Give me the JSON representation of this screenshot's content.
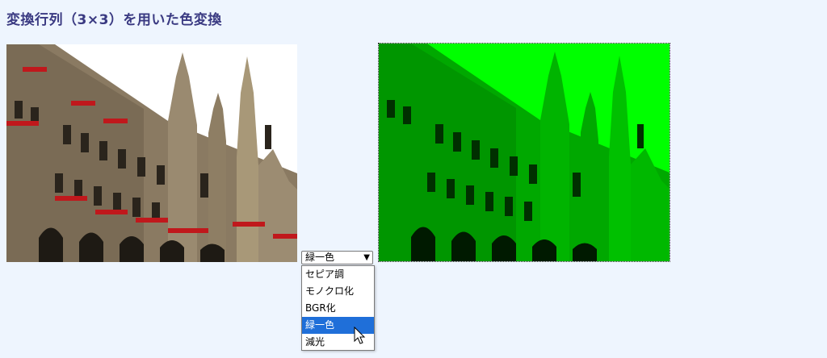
{
  "page": {
    "title": "変換行列（3×3）を用いた色変換"
  },
  "images": {
    "original": {
      "name": "city-hall-photo",
      "alt": ""
    },
    "converted": {
      "name": "green-filtered-photo",
      "alt": ""
    }
  },
  "select": {
    "value": "緑一色",
    "options": [
      "セピア調",
      "モノクロ化",
      "BGR化",
      "緑一色",
      "減光"
    ],
    "selected_index": 3
  },
  "colors": {
    "background": "#eef5fe",
    "title": "#3a3a82",
    "selected_option": "#1f6fd9",
    "green_filter": "#00ff00"
  }
}
